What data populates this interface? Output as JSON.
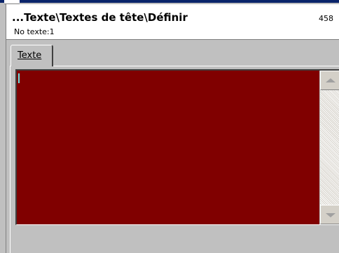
{
  "header": {
    "title": "...Texte\\Textes de tête\\Définir",
    "count": "458",
    "subtitle": "No texte:1"
  },
  "tabs": [
    {
      "label": "Texte",
      "active": true
    }
  ],
  "editor": {
    "content": "",
    "background_color": "#800000"
  },
  "icons": {
    "scroll_up": "scroll-up-arrow-icon",
    "scroll_down": "scroll-down-arrow-icon"
  }
}
